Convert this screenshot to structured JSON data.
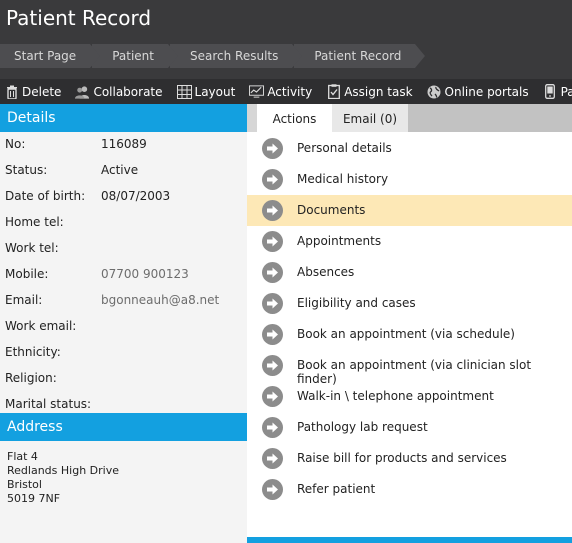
{
  "header": {
    "title": "Patient Record",
    "breadcrumbs": [
      "Start Page",
      "Patient",
      "Search Results",
      "Patient Record"
    ]
  },
  "toolbar": {
    "items": [
      {
        "label": "Delete",
        "icon": "trash-icon"
      },
      {
        "label": "Collaborate",
        "icon": "users-icon"
      },
      {
        "label": "Layout",
        "icon": "grid-icon"
      },
      {
        "label": "Activity",
        "icon": "activity-icon"
      },
      {
        "label": "Assign task",
        "icon": "clipboard-icon"
      },
      {
        "label": "Online portals",
        "icon": "globe-icon"
      },
      {
        "label": "Patient c",
        "icon": "phone-icon"
      }
    ]
  },
  "details": {
    "heading": "Details",
    "rows": [
      {
        "label": "No:",
        "value": "116089"
      },
      {
        "label": "Status:",
        "value": "Active"
      },
      {
        "label": "Date of birth:",
        "value": "08/07/2003"
      },
      {
        "label": "Home tel:",
        "value": ""
      },
      {
        "label": "Work tel:",
        "value": ""
      },
      {
        "label": "Mobile:",
        "value": "07700 900123"
      },
      {
        "label": "Email:",
        "value": "bgonneauh@a8.net"
      },
      {
        "label": "Work email:",
        "value": ""
      },
      {
        "label": "Ethnicity:",
        "value": ""
      },
      {
        "label": "Religion:",
        "value": ""
      },
      {
        "label": "Marital status:",
        "value": ""
      }
    ]
  },
  "address": {
    "heading": "Address",
    "lines": [
      "Flat 4",
      "Redlands High Drive",
      "Bristol",
      "5019 7NF"
    ]
  },
  "tabs": {
    "actions": "Actions",
    "email": "Email (0)"
  },
  "actions": [
    "Personal details",
    "Medical history",
    "Documents",
    "Appointments",
    "Absences",
    "Eligibility and cases",
    "Book an appointment (via schedule)",
    "Book an appointment (via clinician slot finder)",
    "Walk-in \\ telephone appointment",
    "Pathology lab request",
    "Raise bill for products and services",
    "Refer patient"
  ],
  "selected_action": "Documents",
  "colors": {
    "accent": "#13a0e0",
    "header_bg": "#3a3a3c",
    "toolbar_bg": "#2e2e30",
    "selected_row": "#fde8b6"
  }
}
